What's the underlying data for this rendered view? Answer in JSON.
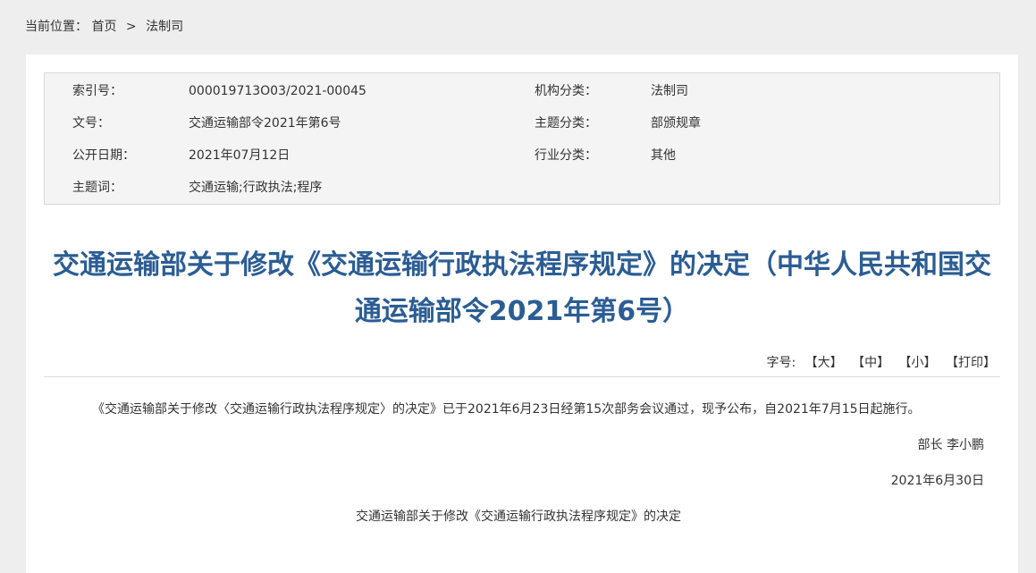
{
  "breadcrumb": {
    "prefix": "当前位置：",
    "home": "首页",
    "separator": ">",
    "current": "法制司"
  },
  "meta": {
    "index_label": "索引号：",
    "index_value": "000019713O03/2021-00045",
    "org_label": "机构分类：",
    "org_value": "法制司",
    "docno_label": "文号：",
    "docno_value": "交通运输部令2021年第6号",
    "topic_label": "主题分类：",
    "topic_value": "部颁规章",
    "date_label": "公开日期：",
    "date_value": "2021年07月12日",
    "industry_label": "行业分类：",
    "industry_value": "其他",
    "keywords_label": "主题词：",
    "keywords_value": "交通运输;行政执法;程序"
  },
  "title": "交通运输部关于修改《交通运输行政执法程序规定》的决定（中华人民共和国交通运输部令2021年第6号）",
  "font_tools": {
    "label": "字号:",
    "large": "【大】",
    "medium": "【中】",
    "small": "【小】",
    "print": "【打印】"
  },
  "content": {
    "paragraph": "《交通运输部关于修改〈交通运输行政执法程序规定〉的决定》已于2021年6月23日经第15次部务会议通过，现予公布，自2021年7月15日起施行。",
    "signer": "部长 李小鹏",
    "sign_date": "2021年6月30日",
    "subtitle": "交通运输部关于修改《交通运输行政执法程序规定》的决定"
  },
  "colors": {
    "title": "#2b5d94",
    "background": "#eeeeee",
    "meta_bg": "#f4f4f4"
  }
}
